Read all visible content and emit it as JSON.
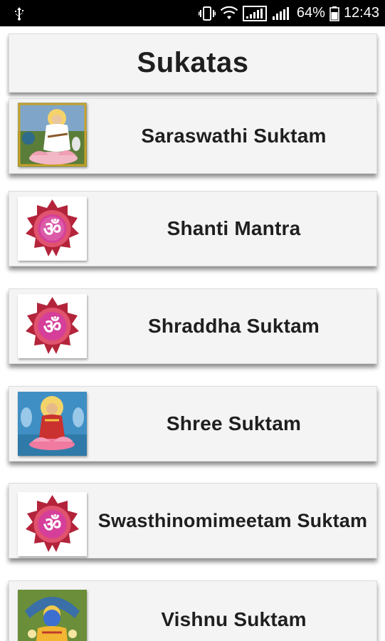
{
  "status_bar": {
    "battery_percent": "64%",
    "time": "12:43",
    "icons": [
      "usb-icon",
      "vibrate-icon",
      "wifi-icon",
      "signal-icon",
      "signal-icon-2",
      "battery-icon"
    ]
  },
  "header": {
    "title": "Sukatas"
  },
  "items": [
    {
      "label": "Saraswathi Suktam",
      "thumb": "saraswathi-image"
    },
    {
      "label": "Shanti Mantra",
      "thumb": "om-icon"
    },
    {
      "label": "Shraddha Suktam",
      "thumb": "om-icon"
    },
    {
      "label": "Shree Suktam",
      "thumb": "lakshmi-image"
    },
    {
      "label": "Swasthinomimeetam Suktam",
      "thumb": "om-icon"
    },
    {
      "label": "Vishnu Suktam",
      "thumb": "vishnu-image"
    }
  ]
}
